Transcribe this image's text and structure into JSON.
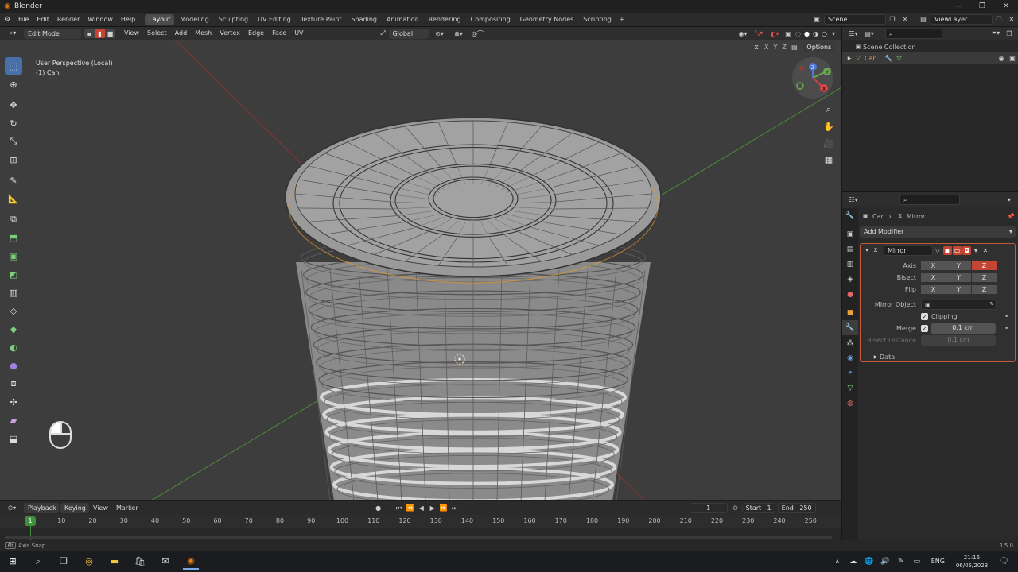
{
  "window": {
    "title": "Blender",
    "app_icon": "blender-icon"
  },
  "menus": [
    "File",
    "Edit",
    "Render",
    "Window",
    "Help"
  ],
  "workspaces": [
    "Layout",
    "Modeling",
    "Sculpting",
    "UV Editing",
    "Texture Paint",
    "Shading",
    "Animation",
    "Rendering",
    "Compositing",
    "Geometry Nodes",
    "Scripting"
  ],
  "active_workspace": "Layout",
  "scene": {
    "name": "Scene",
    "view_layer": "ViewLayer"
  },
  "viewport_header": {
    "mode": "Edit Mode",
    "menus": [
      "View",
      "Select",
      "Add",
      "Mesh",
      "Vertex",
      "Edge",
      "Face",
      "UV"
    ],
    "transform_orientation": "Global",
    "options_label": "Options",
    "mirror_axes": [
      "X",
      "Y",
      "Z"
    ]
  },
  "viewport": {
    "perspective_label": "User Perspective (Local)",
    "object_label": "(1) Can",
    "gizmo_axes": {
      "x": "X",
      "y": "Y",
      "z": "Z"
    },
    "colors": {
      "background": "#3d3d3d",
      "x_axis": "#9b3b3b",
      "y_axis": "#4e8a3a",
      "selection": "#e89a2c"
    }
  },
  "outliner": {
    "root": "Scene Collection",
    "items": [
      {
        "name": "Can"
      }
    ]
  },
  "properties": {
    "breadcrumb": {
      "object": "Can",
      "modifier": "Mirror"
    },
    "add_modifier_label": "Add Modifier",
    "modifier": {
      "name": "Mirror",
      "axis_label": "Axis",
      "bisect_label": "Bisect",
      "flip_label": "Flip",
      "axes": [
        "X",
        "Y",
        "Z"
      ],
      "axis_active": "Z",
      "mirror_object_label": "Mirror Object",
      "clipping_label": "Clipping",
      "clipping_checked": true,
      "merge_label": "Merge",
      "merge_checked": true,
      "merge_value": "0.1 cm",
      "bisect_distance_label": "Bisect Distance",
      "bisect_distance_value": "0.1 cm",
      "data_label": "Data"
    }
  },
  "timeline": {
    "menus": [
      "Playback",
      "Keying",
      "View",
      "Marker"
    ],
    "current_frame": "1",
    "start_label": "Start",
    "start_value": "1",
    "end_label": "End",
    "end_value": "250",
    "ticks": [
      "10",
      "20",
      "30",
      "40",
      "50",
      "60",
      "70",
      "80",
      "90",
      "100",
      "110",
      "120",
      "130",
      "140",
      "150",
      "160",
      "170",
      "180",
      "190",
      "200",
      "210",
      "220",
      "230",
      "240",
      "250"
    ],
    "playhead": "1"
  },
  "statusbar": {
    "left": "Axis Snap",
    "version": "3.5.0"
  },
  "taskbar": {
    "language": "ENG",
    "time": "21:16",
    "date": "06/05/2023"
  }
}
